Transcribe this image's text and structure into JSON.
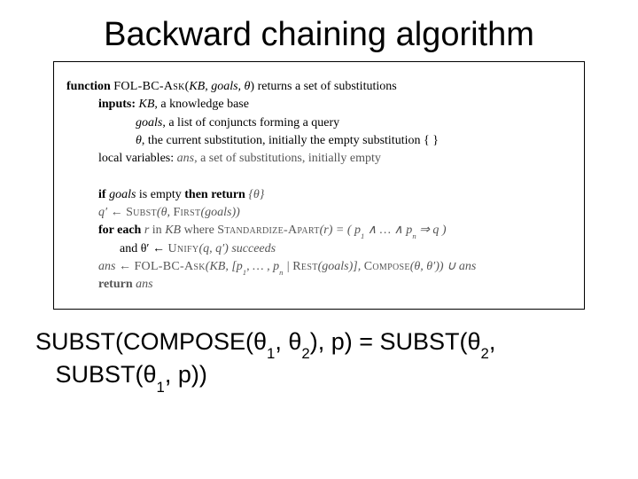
{
  "title": "Backward chaining algorithm",
  "alg": {
    "l1a": "function ",
    "l1b": "FOL-BC-Ask",
    "l1c": "(",
    "l1d": "KB, goals, θ",
    "l1e": ") returns",
    "l1f": " a set of substitutions",
    "l2a": "inputs: ",
    "l2b": "KB",
    "l2c": ", a knowledge base",
    "l3a": "goals",
    "l3b": ", a list of conjuncts forming a query",
    "l4a": "θ",
    "l4b": ", the current substitution, initially the empty substitution { }",
    "l5a": "local variables: ",
    "l5b": "ans",
    "l5c": ", a set of substitutions, initially empty",
    "l6a": "if ",
    "l6b": "goals",
    "l6c": " is empty ",
    "l6d": "then return ",
    "l6e": "{θ}",
    "l7a": "q′ ← ",
    "l7b": "Subst",
    "l7c": "(θ, ",
    "l7d": "First",
    "l7e": "(goals))",
    "l8a": "for each ",
    "l8b": "r",
    "l8c": " in ",
    "l8d": "KB",
    "l8e": " where ",
    "l8f": "Standardize-Apart",
    "l8g": "(r) = ( p",
    "l8g2": "1",
    "l8h": " ∧ … ∧ p",
    "l8h2": "n",
    "l8i": " ⇒ q )",
    "l9a": "and θ′ ← ",
    "l9b": "Unify",
    "l9c": "(q, q′) succeeds",
    "l10a": "ans ← ",
    "l10b": "FOL-BC-Ask",
    "l10c": "(KB, [p",
    "l10c2": "1",
    "l10d": ", … , p",
    "l10d2": "n",
    "l10e": " | ",
    "l10f": "Rest",
    "l10g": "(goals)], ",
    "l10h": "Compose",
    "l10i": "(θ, θ′)) ∪ ans",
    "l11a": "return ",
    "l11b": "ans"
  },
  "eq": {
    "p1": "SUBST(COMPOSE(θ",
    "s1": "1",
    "p2": ", θ",
    "s2": "2",
    "p3": "), p) = SUBST(θ",
    "s3": "2",
    "p4": ", ",
    "p5": "SUBST(θ",
    "s5": "1",
    "p6": ", p))"
  }
}
